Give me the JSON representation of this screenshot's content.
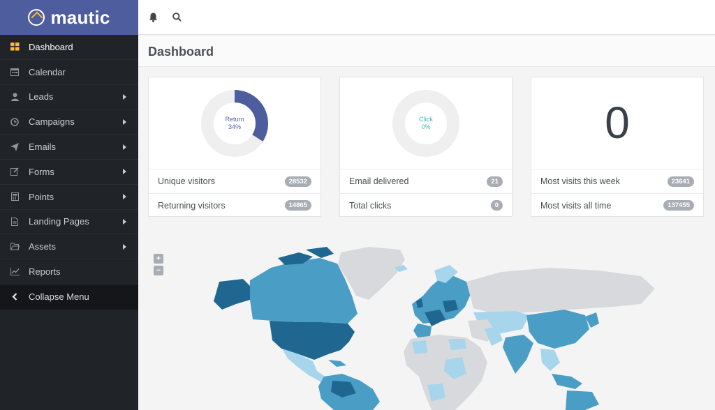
{
  "app": {
    "brand": "mautic"
  },
  "sidebar": {
    "items": [
      {
        "label": "Dashboard",
        "icon": "dashboard-icon",
        "active": true
      },
      {
        "label": "Calendar",
        "icon": "calendar-icon"
      },
      {
        "label": "Leads",
        "icon": "user-icon",
        "submenu": true
      },
      {
        "label": "Campaigns",
        "icon": "clock-icon",
        "submenu": true
      },
      {
        "label": "Emails",
        "icon": "paper-plane-icon",
        "submenu": true
      },
      {
        "label": "Forms",
        "icon": "edit-icon",
        "submenu": true
      },
      {
        "label": "Points",
        "icon": "calculator-icon",
        "submenu": true
      },
      {
        "label": "Landing Pages",
        "icon": "file-icon",
        "submenu": true
      },
      {
        "label": "Assets",
        "icon": "folder-icon",
        "submenu": true
      },
      {
        "label": "Reports",
        "icon": "line-chart-icon"
      },
      {
        "label": "Collapse Menu",
        "icon": "chevron-left-icon"
      }
    ]
  },
  "topbar": {
    "icons": [
      "bell-icon",
      "search-icon"
    ]
  },
  "page": {
    "title": "Dashboard"
  },
  "cards": [
    {
      "donut": {
        "label": "Return",
        "value_text": "34%",
        "fraction": 0.34,
        "color": "#4e5d9d"
      },
      "rows": [
        {
          "label": "Unique visitors",
          "badge": "28532"
        },
        {
          "label": "Returning visitors",
          "badge": "14865"
        }
      ]
    },
    {
      "donut": {
        "label": "Click",
        "value_text": "0%",
        "fraction": 0,
        "color": "#35b5b9"
      },
      "rows": [
        {
          "label": "Email delivered",
          "badge": "21"
        },
        {
          "label": "Total clicks",
          "badge": "0"
        }
      ]
    },
    {
      "big_number": "0",
      "rows": [
        {
          "label": "Most visits this week",
          "badge": "23641"
        },
        {
          "label": "Most visits all time",
          "badge": "137455"
        }
      ]
    }
  ],
  "map": {
    "zoom_in": "+",
    "zoom_out": "−"
  },
  "colors": {
    "sidebar_bg": "#202327",
    "brand_bg": "#4e5d9d",
    "accent_orange": "#fdb933",
    "map_dark": "#1f6791",
    "map_mid": "#4a9ec5",
    "map_light": "#a7d5ec",
    "map_none": "#d8d9dc"
  }
}
